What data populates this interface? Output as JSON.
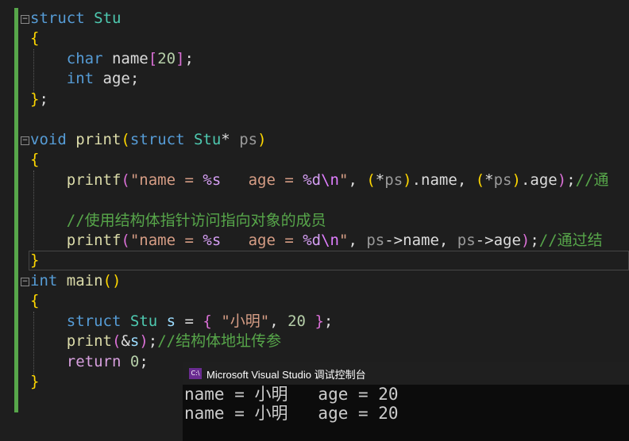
{
  "code": {
    "l1": {
      "kw": "struct",
      "name": "Stu"
    },
    "l2": {
      "brace": "{"
    },
    "l3": {
      "type": "char",
      "name": "name",
      "b1": "[",
      "num": "20",
      "b2": "]",
      "semi": ";"
    },
    "l4": {
      "type": "int",
      "name": "age",
      "semi": ";"
    },
    "l5": {
      "brace": "}",
      "semi": ";"
    },
    "l6": {
      "type": "void",
      "fn": "print",
      "p1": "(",
      "kw": "struct",
      "ty": "Stu",
      "star": "*",
      "param": "ps",
      "p2": ")"
    },
    "l7": {
      "brace": "{"
    },
    "l8": {
      "fn": "printf",
      "p1": "(",
      "q1": "\"name = ",
      "f1": "%s",
      "mid": "   age = ",
      "f2": "%d",
      "esc": "\\n",
      "q2": "\"",
      "rest1": ", ",
      "b1": "(",
      "star": "*",
      "ps": "ps",
      "b2": ")",
      "dot1": ".",
      "m1": "name",
      "rest2": ", ",
      "b3": "(",
      "star2": "*",
      "ps2": "ps",
      "b4": ")",
      "dot2": ".",
      "m2": "age",
      "p2": ")",
      "semi": ";",
      "cmt": "//通"
    },
    "l9": {
      "cmt": "//使用结构体指针访问指向对象的成员"
    },
    "l10": {
      "fn": "printf",
      "p1": "(",
      "q1": "\"name = ",
      "f1": "%s",
      "mid": "   age = ",
      "f2": "%d",
      "esc": "\\n",
      "q2": "\"",
      "rest1": ", ",
      "ps": "ps",
      "arrow1": "->",
      "m1": "name",
      "rest2": ", ",
      "ps2": "ps",
      "arrow2": "->",
      "m2": "age",
      "p2": ")",
      "semi": ";",
      "cmt": "//通过结"
    },
    "l11": {
      "brace": "}"
    },
    "l12": {
      "type": "int",
      "fn": "main",
      "p": "()"
    },
    "l13": {
      "brace": "{"
    },
    "l14": {
      "kw": "struct",
      "ty": "Stu",
      "var": "s",
      "eq": " = ",
      "b1": "{",
      "str": "\"小明\"",
      "comma": ", ",
      "num": "20",
      "b2": "}",
      "semi": ";"
    },
    "l15": {
      "fn": "print",
      "p1": "(",
      "amp": "&",
      "var": "s",
      "p2": ")",
      "semi": ";",
      "cmt": "//结构体地址传参"
    },
    "l16": {
      "kw": "return",
      "num": "0",
      "semi": ";"
    },
    "l17": {
      "brace": "}"
    }
  },
  "console": {
    "title": "Microsoft Visual Studio 调试控制台",
    "icon_text": "C:\\",
    "lines": [
      "name = 小明   age = 20",
      "name = 小明   age = 20"
    ]
  }
}
